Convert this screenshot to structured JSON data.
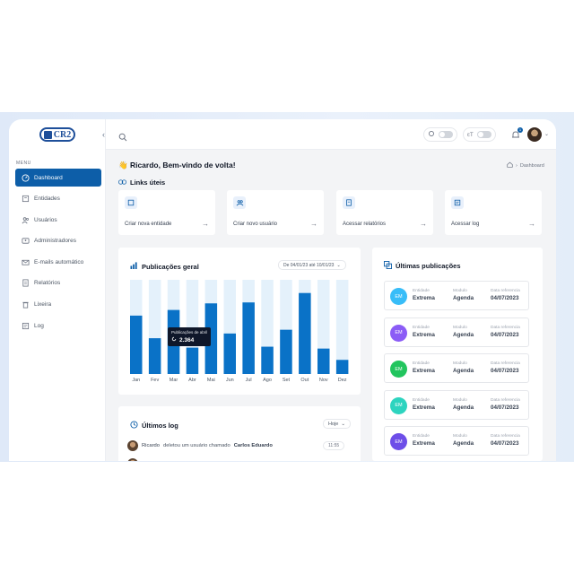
{
  "brand": {
    "logo_text": "CR2"
  },
  "sidebar": {
    "menu_label": "MENU",
    "items": [
      {
        "label": "Dashboard",
        "icon": "gauge-icon",
        "active": true
      },
      {
        "label": "Entidades",
        "icon": "building-icon"
      },
      {
        "label": "Usuários",
        "icon": "users-icon"
      },
      {
        "label": "Administradores",
        "icon": "id-card-icon"
      },
      {
        "label": "E-mails automático",
        "icon": "mail-icon"
      },
      {
        "label": "Relatórios",
        "icon": "report-icon"
      },
      {
        "label": "Lixeira",
        "icon": "trash-icon"
      },
      {
        "label": "Log",
        "icon": "log-icon"
      }
    ]
  },
  "topbar": {
    "font_label": "ꞇT",
    "notification_count": "1"
  },
  "header": {
    "welcome": "👋 Ricardo, Bem-vindo de volta!",
    "breadcrumb": "Dashboard"
  },
  "links": {
    "title": "Links úteis",
    "items": [
      {
        "label": "Criar nova entidade",
        "icon": "building-icon"
      },
      {
        "label": "Criar novo usuário",
        "icon": "users-icon"
      },
      {
        "label": "Acessar relatórios",
        "icon": "report-icon"
      },
      {
        "label": "Acessar log",
        "icon": "log-icon"
      }
    ]
  },
  "publications_chart": {
    "title": "Publicações geral",
    "date_range": "De 04/01/23 até 10/01/23",
    "tooltip_label": "Publicações de abril",
    "tooltip_value": "2.364"
  },
  "chart_data": {
    "type": "bar",
    "categories": [
      "Jan",
      "Fev",
      "Mar",
      "Abr",
      "Mai",
      "Jun",
      "Jul",
      "Ago",
      "Set",
      "Out",
      "Nov",
      "Dez"
    ],
    "values": [
      62,
      38,
      68,
      28,
      75,
      43,
      76,
      29,
      47,
      86,
      27,
      15
    ],
    "ylim": [
      0,
      100
    ],
    "colors": {
      "bar": "#0a72c7",
      "track": "#e4f1fb"
    }
  },
  "latest_publications": {
    "title": "Últimas publicações",
    "labels": {
      "entity": "Entidade",
      "module": "Modulo",
      "date": "Data referencia"
    },
    "items": [
      {
        "initials": "EM",
        "entity": "Extrema",
        "module": "Agenda",
        "date": "04/07/2023",
        "color": "#38bdf8"
      },
      {
        "initials": "EM",
        "entity": "Extrema",
        "module": "Agenda",
        "date": "04/07/2023",
        "color": "#8b5cf6"
      },
      {
        "initials": "EM",
        "entity": "Extrema",
        "module": "Agenda",
        "date": "04/07/2023",
        "color": "#22c55e"
      },
      {
        "initials": "EM",
        "entity": "Extrema",
        "module": "Agenda",
        "date": "04/07/2023",
        "color": "#2dd4bf"
      },
      {
        "initials": "EM",
        "entity": "Extrema",
        "module": "Agenda",
        "date": "04/07/2023",
        "color": "#6d4ee8"
      }
    ]
  },
  "latest_log": {
    "title": "Últimos log",
    "filter": "Hoje",
    "entries": [
      {
        "user": "Ricardo",
        "action": "deletou um usuário chamado",
        "target": "Carlos Eduardo",
        "time": "11:55"
      }
    ]
  }
}
